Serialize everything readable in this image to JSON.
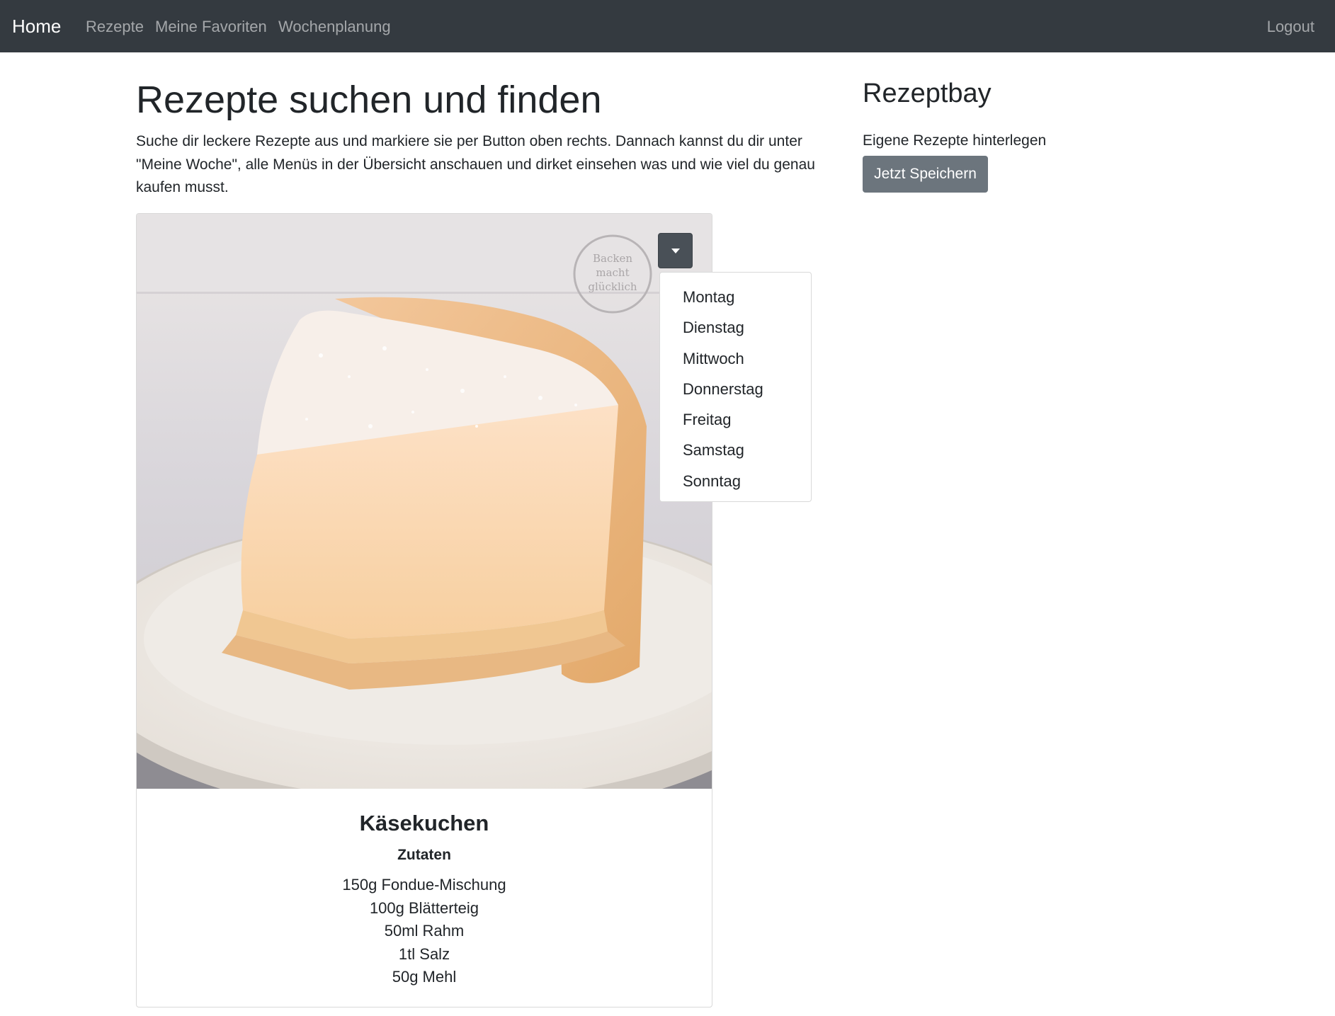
{
  "navbar": {
    "brand": "Home",
    "links": [
      "Rezepte",
      "Meine Favoriten",
      "Wochenplanung"
    ],
    "logout": "Logout",
    "bg_color": "#343a40"
  },
  "main": {
    "title": "Rezepte suchen und finden",
    "intro": "Suche dir leckere Rezepte aus und markiere sie per Button oben rechts. Dannach kannst du dir unter \"Meine Woche\", alle Menüs in der Übersicht anschauen und dirket einsehen was und wie viel du genau kaufen musst."
  },
  "card": {
    "image": "cheesecake-photo",
    "stamp_text": [
      "Backen",
      "macht",
      "glücklich"
    ],
    "title": "Käsekuchen",
    "ingredients_heading": "Zutaten",
    "ingredients": [
      "150g Fondue-Mischung",
      "100g Blätterteig",
      "50ml Rahm",
      "1tl Salz",
      "50g Mehl"
    ]
  },
  "day_dropdown": {
    "toggle_icon": "caret-down-icon",
    "expanded": true,
    "items": [
      "Montag",
      "Dienstag",
      "Mittwoch",
      "Donnerstag",
      "Freitag",
      "Samstag",
      "Sonntag"
    ]
  },
  "sidebar": {
    "title": "Rezeptbay",
    "text": "Eigene Rezepte hinterlegen",
    "button": "Jetzt Speichern",
    "button_color": "#6c757d"
  }
}
